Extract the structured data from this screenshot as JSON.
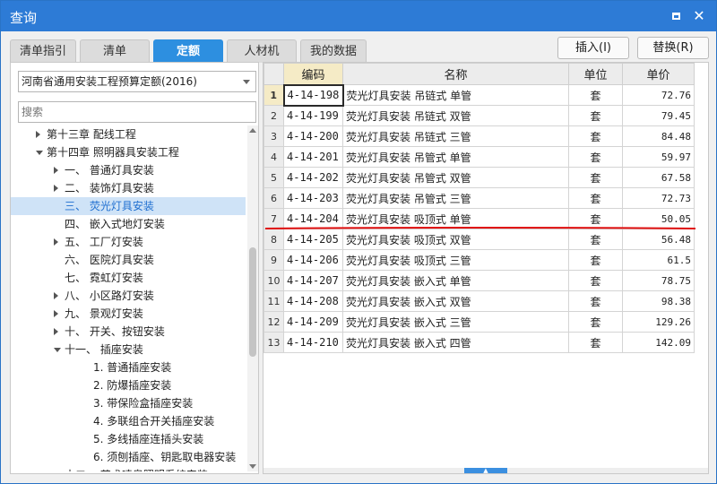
{
  "window": {
    "title": "查询",
    "maximize_icon": "maximize-icon",
    "close_glyph": "✕"
  },
  "tabs": [
    {
      "label": "清单指引",
      "active": false
    },
    {
      "label": "清单",
      "active": false
    },
    {
      "label": "定额",
      "active": true
    },
    {
      "label": "人材机",
      "active": false
    },
    {
      "label": "我的数据",
      "active": false
    }
  ],
  "actions": {
    "insert_label": "插入(I)",
    "replace_label": "替换(R)"
  },
  "library": {
    "selected": "河南省通用安装工程预算定额(2016)"
  },
  "search": {
    "placeholder": "搜索"
  },
  "tree": [
    {
      "label": "第十三章 配线工程",
      "caret": "right",
      "level": 1,
      "selected": false
    },
    {
      "label": "第十四章 照明器具安装工程",
      "caret": "down",
      "level": 1,
      "selected": false
    },
    {
      "label": "一、 普通灯具安装",
      "caret": "right",
      "level": 2,
      "selected": false
    },
    {
      "label": "二、 装饰灯具安装",
      "caret": "right",
      "level": 2,
      "selected": false
    },
    {
      "label": "三、 荧光灯具安装",
      "caret": "",
      "level": 2,
      "selected": true
    },
    {
      "label": "四、 嵌入式地灯安装",
      "caret": "",
      "level": 2,
      "selected": false
    },
    {
      "label": "五、 工厂灯安装",
      "caret": "right",
      "level": 2,
      "selected": false
    },
    {
      "label": "六、 医院灯具安装",
      "caret": "",
      "level": 2,
      "selected": false
    },
    {
      "label": "七、 霓虹灯安装",
      "caret": "",
      "level": 2,
      "selected": false
    },
    {
      "label": "八、 小区路灯安装",
      "caret": "right",
      "level": 2,
      "selected": false
    },
    {
      "label": "九、 景观灯安装",
      "caret": "right",
      "level": 2,
      "selected": false
    },
    {
      "label": "十、 开关、按钮安装",
      "caret": "right",
      "level": 2,
      "selected": false
    },
    {
      "label": "十一、 插座安装",
      "caret": "down",
      "level": 2,
      "selected": false
    },
    {
      "label": "1. 普通插座安装",
      "caret": "",
      "level": 3,
      "selected": false
    },
    {
      "label": "2. 防爆插座安装",
      "caret": "",
      "level": 3,
      "selected": false
    },
    {
      "label": "3. 带保险盒插座安装",
      "caret": "",
      "level": 3,
      "selected": false
    },
    {
      "label": "4. 多联组合开关插座安装",
      "caret": "",
      "level": 3,
      "selected": false
    },
    {
      "label": "5. 多线插座连插头安装",
      "caret": "",
      "level": 3,
      "selected": false
    },
    {
      "label": "6. 须刨插座、钥匙取电器安装",
      "caret": "",
      "level": 3,
      "selected": false
    },
    {
      "label": "十二、 艺术喷泉照明系统安装",
      "caret": "right",
      "level": 2,
      "selected": false
    }
  ],
  "table": {
    "headers": {
      "code": "编码",
      "name": "名称",
      "unit": "单位",
      "price": "单价"
    },
    "rows": [
      {
        "no": "1",
        "code": "4-14-198",
        "name": "荧光灯具安装 吊链式 单管",
        "unit": "套",
        "price": "72.76",
        "selected": true
      },
      {
        "no": "2",
        "code": "4-14-199",
        "name": "荧光灯具安装 吊链式 双管",
        "unit": "套",
        "price": "79.45",
        "selected": false
      },
      {
        "no": "3",
        "code": "4-14-200",
        "name": "荧光灯具安装 吊链式 三管",
        "unit": "套",
        "price": "84.48",
        "selected": false
      },
      {
        "no": "4",
        "code": "4-14-201",
        "name": "荧光灯具安装 吊管式 单管",
        "unit": "套",
        "price": "59.97",
        "selected": false
      },
      {
        "no": "5",
        "code": "4-14-202",
        "name": "荧光灯具安装 吊管式 双管",
        "unit": "套",
        "price": "67.58",
        "selected": false
      },
      {
        "no": "6",
        "code": "4-14-203",
        "name": "荧光灯具安装 吊管式 三管",
        "unit": "套",
        "price": "72.73",
        "selected": false
      },
      {
        "no": "7",
        "code": "4-14-204",
        "name": "荧光灯具安装 吸顶式 单管",
        "unit": "套",
        "price": "50.05",
        "selected": false
      },
      {
        "no": "8",
        "code": "4-14-205",
        "name": "荧光灯具安装 吸顶式 双管",
        "unit": "套",
        "price": "56.48",
        "selected": false
      },
      {
        "no": "9",
        "code": "4-14-206",
        "name": "荧光灯具安装 吸顶式 三管",
        "unit": "套",
        "price": "61.5",
        "selected": false
      },
      {
        "no": "10",
        "code": "4-14-207",
        "name": "荧光灯具安装 嵌入式 单管",
        "unit": "套",
        "price": "78.75",
        "selected": false
      },
      {
        "no": "11",
        "code": "4-14-208",
        "name": "荧光灯具安装 嵌入式 双管",
        "unit": "套",
        "price": "98.38",
        "selected": false
      },
      {
        "no": "12",
        "code": "4-14-209",
        "name": "荧光灯具安装 嵌入式 三管",
        "unit": "套",
        "price": "129.26",
        "selected": false
      },
      {
        "no": "13",
        "code": "4-14-210",
        "name": "荧光灯具安装 嵌入式 四管",
        "unit": "套",
        "price": "142.09",
        "selected": false
      }
    ]
  },
  "colors": {
    "titlebar": "#2d7bd6",
    "active_tab": "#2d8fe0",
    "annotation_line": "#e01010",
    "selected_tree": "#cfe3f7"
  }
}
